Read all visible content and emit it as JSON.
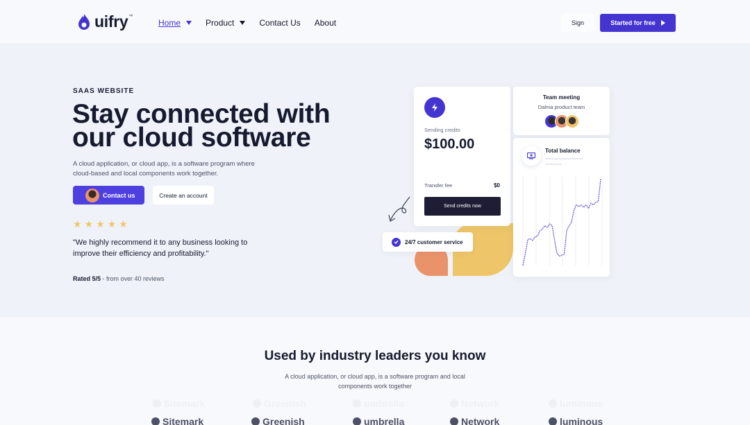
{
  "nav": {
    "brand": "uifry",
    "brand_tm": "™",
    "links": [
      {
        "label": "Home",
        "active": true,
        "has_dropdown": true
      },
      {
        "label": "Product",
        "active": false,
        "has_dropdown": true
      },
      {
        "label": "Contact Us",
        "active": false,
        "has_dropdown": false
      },
      {
        "label": "About",
        "active": false,
        "has_dropdown": false
      }
    ],
    "sign_label": "Sign",
    "start_label": "Started for free",
    "accent": "#4535d0"
  },
  "hero": {
    "eyebrow": "SAAS WEBSITE",
    "headline_line1": "Stay connected with",
    "headline_line2": "our cloud software",
    "subtitle": "A cloud application, or cloud app, is a software program where cloud-based and local components work together.",
    "contact_label": "Contact us",
    "create_label": "Create an account",
    "rating_stars": 5,
    "quote": "\"We highly recommend it to any business looking to improve their efficiency and profitability.\"",
    "rated_bold": "Rated 5/5",
    "rated_rest": " - from over 40 reviews"
  },
  "send_card": {
    "label": "Sending credits",
    "amount": "$100.00",
    "fee_label": "Transfer fee",
    "fee_value": "$0",
    "button": "Send credits now"
  },
  "team_card": {
    "title": "Team meeting",
    "subtitle": "Dalma product team",
    "avatar_count": 3
  },
  "balance_card": {
    "title": "Total balance",
    "series": [
      0,
      14,
      30,
      31,
      29,
      33,
      34,
      40,
      42,
      46,
      44,
      48,
      46,
      30,
      14,
      11,
      12,
      13,
      40,
      46,
      50,
      64,
      70,
      68,
      70,
      67,
      70,
      66,
      72,
      70,
      73,
      74,
      100
    ]
  },
  "service_badge": "24/7 customer service",
  "leaders": {
    "title": "Used by industry leaders you know",
    "subtitle": "A cloud application, or cloud app, is a software program and local components work together",
    "brands": [
      "Sitemark",
      "Greenish",
      "umbrella",
      "Network",
      "luminous"
    ]
  }
}
